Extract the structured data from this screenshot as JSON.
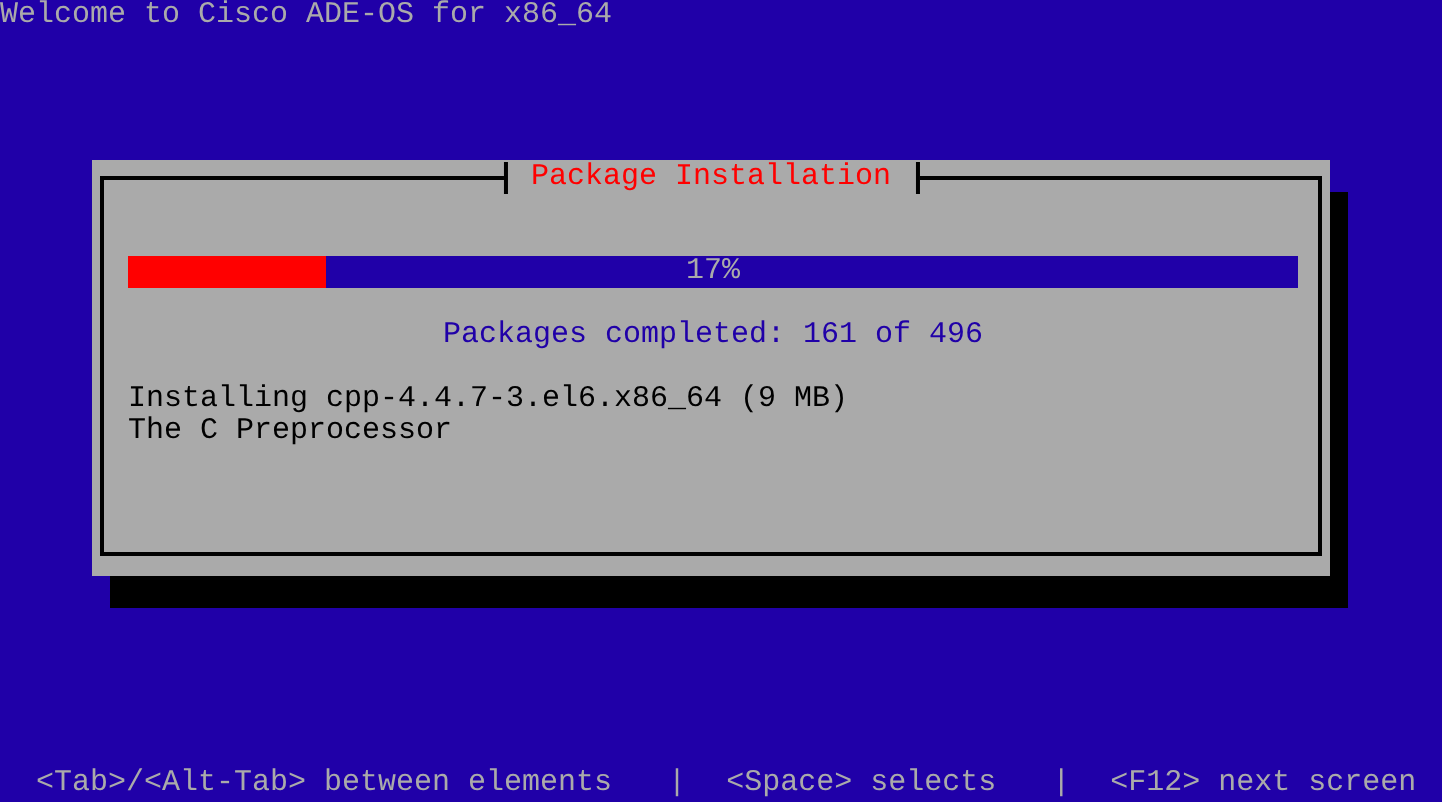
{
  "header": {
    "title": "Welcome to Cisco ADE-OS for x86_64"
  },
  "dialog": {
    "title": "Package Installation",
    "progress": {
      "level": 0.17,
      "reading": "17%"
    },
    "summary": "Packages completed: 161 of 496",
    "lines": [
      "Installing cpp-4.4.7-3.el6.x86_64 (9 MB)",
      "The C Preprocessor"
    ]
  },
  "help_bar": {
    "separator": "|",
    "items": [
      "<Tab>/<Alt-Tab> between elements",
      "<Space> selects",
      "<F12> next screen"
    ]
  }
}
